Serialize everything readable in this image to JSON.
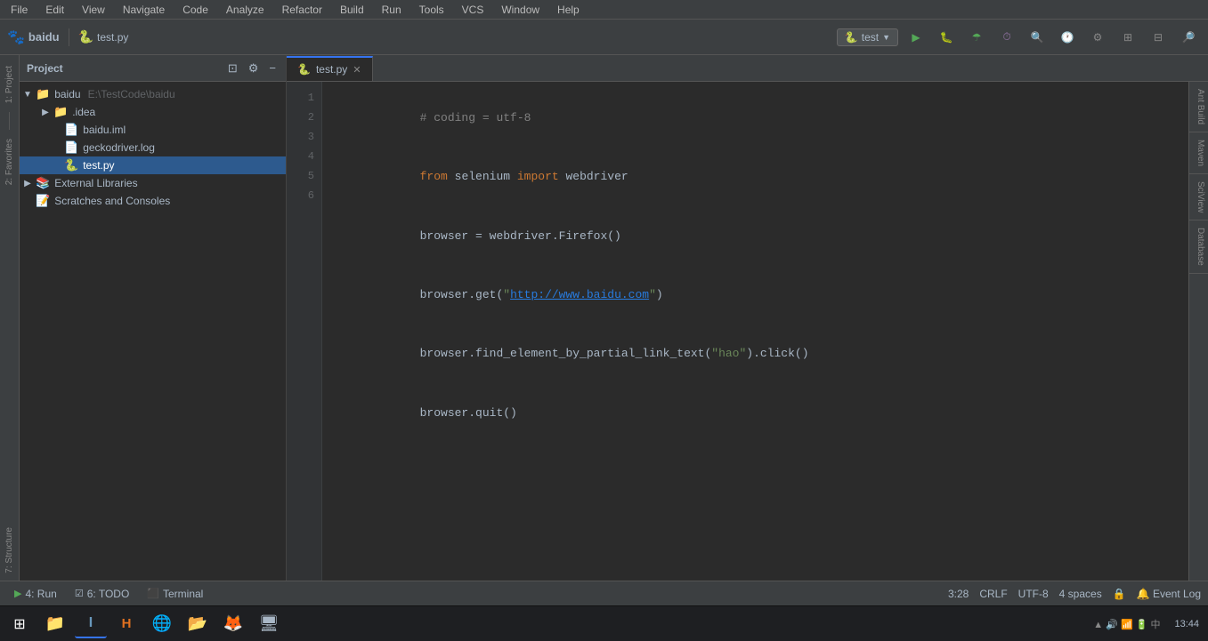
{
  "menubar": {
    "items": [
      "File",
      "Edit",
      "View",
      "Navigate",
      "Code",
      "Analyze",
      "Refactor",
      "Build",
      "Run",
      "Tools",
      "VCS",
      "Window",
      "Help"
    ]
  },
  "toolbar": {
    "logo": "baidu",
    "logo_icon": "🐾",
    "file_icon": "🐍",
    "file_name": "test.py",
    "run_config": "test",
    "run_config_icon": "🐍"
  },
  "project_panel": {
    "title": "Project",
    "tree": [
      {
        "level": 0,
        "arrow": "▼",
        "icon": "folder",
        "name": "baidu",
        "detail": "E:\\TestCode\\baidu"
      },
      {
        "level": 1,
        "arrow": "▶",
        "icon": "folder",
        "name": ".idea",
        "detail": ""
      },
      {
        "level": 1,
        "arrow": "",
        "icon": "iml",
        "name": "baidu.iml",
        "detail": ""
      },
      {
        "level": 1,
        "arrow": "",
        "icon": "log",
        "name": "geckodriver.log",
        "detail": ""
      },
      {
        "level": 1,
        "arrow": "",
        "icon": "python",
        "name": "test.py",
        "detail": "",
        "selected": true
      },
      {
        "level": 0,
        "arrow": "▶",
        "icon": "ext",
        "name": "External Libraries",
        "detail": ""
      },
      {
        "level": 0,
        "arrow": "",
        "icon": "scratch",
        "name": "Scratches and Consoles",
        "detail": ""
      }
    ]
  },
  "editor": {
    "tab_name": "test.py",
    "lines": [
      {
        "num": 1,
        "content": "# coding = utf-8",
        "type": "comment"
      },
      {
        "num": 2,
        "content": "from selenium import webdriver",
        "type": "import"
      },
      {
        "num": 3,
        "content": "browser = webdriver.Firefox()",
        "type": "code"
      },
      {
        "num": 4,
        "content": "browser.get(\"http://www.baidu.com\")",
        "type": "code_url"
      },
      {
        "num": 5,
        "content": "browser.find_element_by_partial_link_text(\"hao\").click()",
        "type": "code"
      },
      {
        "num": 6,
        "content": "browser.quit()",
        "type": "code"
      }
    ]
  },
  "right_tabs": [
    {
      "label": "Ant Build"
    },
    {
      "label": "Maven"
    },
    {
      "label": "SciView"
    },
    {
      "label": "Database"
    }
  ],
  "bottom_toolbar": {
    "run_label": "4: Run",
    "todo_label": "6: TODO",
    "terminal_label": "Terminal",
    "position": "3:28",
    "line_sep": "CRLF",
    "encoding": "UTF-8",
    "indent": "4 spaces",
    "event_log": "Event Log"
  },
  "taskbar": {
    "time": "13:44",
    "apps": [
      "⊞",
      "📁",
      "💻",
      "🅗",
      "🌐",
      "📂",
      "🦊",
      "🖥"
    ]
  },
  "status_bar": {
    "position": "3:28",
    "line_sep": "CRLF",
    "encoding": "UTF-8",
    "indent": "4 spaces",
    "event_log_label": "Event Log",
    "git_icon": "🔒"
  }
}
